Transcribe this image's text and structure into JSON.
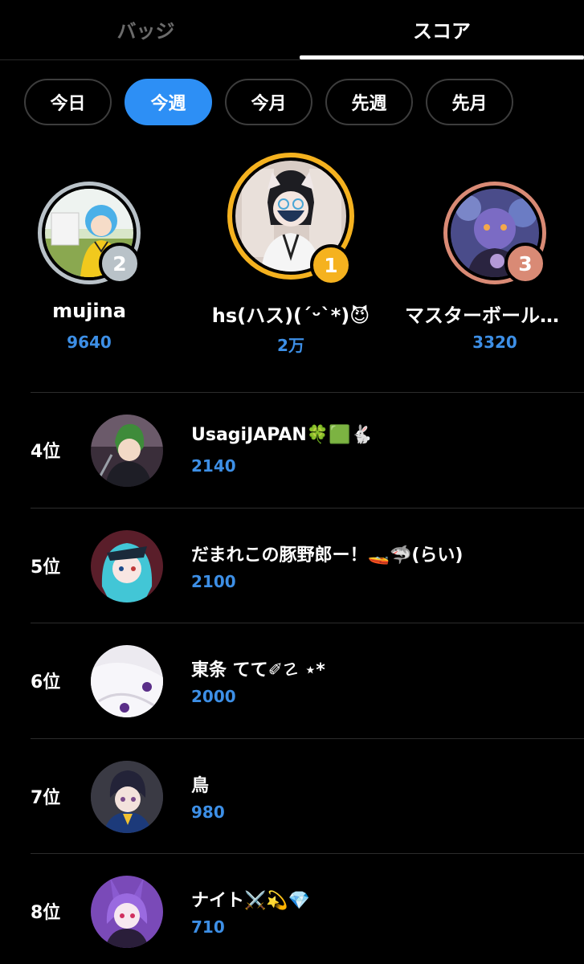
{
  "tabs": [
    {
      "label": "バッジ",
      "active": false
    },
    {
      "label": "スコア",
      "active": true
    }
  ],
  "periods": [
    {
      "label": "今日",
      "active": false
    },
    {
      "label": "今週",
      "active": true
    },
    {
      "label": "今月",
      "active": false
    },
    {
      "label": "先週",
      "active": false
    },
    {
      "label": "先月",
      "active": false
    }
  ],
  "podium": {
    "first": {
      "rank": "1",
      "name": "hs(ハス)(ˊᵕˋ*)😈",
      "score": "2万",
      "ring_color": "#f5b21f",
      "avatar_icon": "avatar-icon"
    },
    "second": {
      "rank": "2",
      "name": "mujina",
      "score": "9640",
      "ring_color": "#b9c2c8",
      "avatar_icon": "avatar-icon"
    },
    "third": {
      "rank": "3",
      "name": "マスターボール…",
      "score": "3320",
      "ring_color": "#d98a75",
      "avatar_icon": "avatar-icon"
    }
  },
  "list": [
    {
      "rank": "4位",
      "name": "UsagiJAPAN🍀🟩🐇",
      "score": "2140"
    },
    {
      "rank": "5位",
      "name": "だまれこの豚野郎ー！🚤🦈(らい)",
      "score": "2100"
    },
    {
      "rank": "6位",
      "name": "東条 てて✐☡ ⋆*",
      "score": "2000"
    },
    {
      "rank": "7位",
      "name": "鳥",
      "score": "980"
    },
    {
      "rank": "8位",
      "name": "ナイト⚔️💫💎",
      "score": "710"
    }
  ],
  "colors": {
    "accent": "#2d8ff5",
    "score": "#3d8fe6",
    "gold": "#f5b21f",
    "silver": "#b9c2c8",
    "bronze": "#d98a75"
  }
}
